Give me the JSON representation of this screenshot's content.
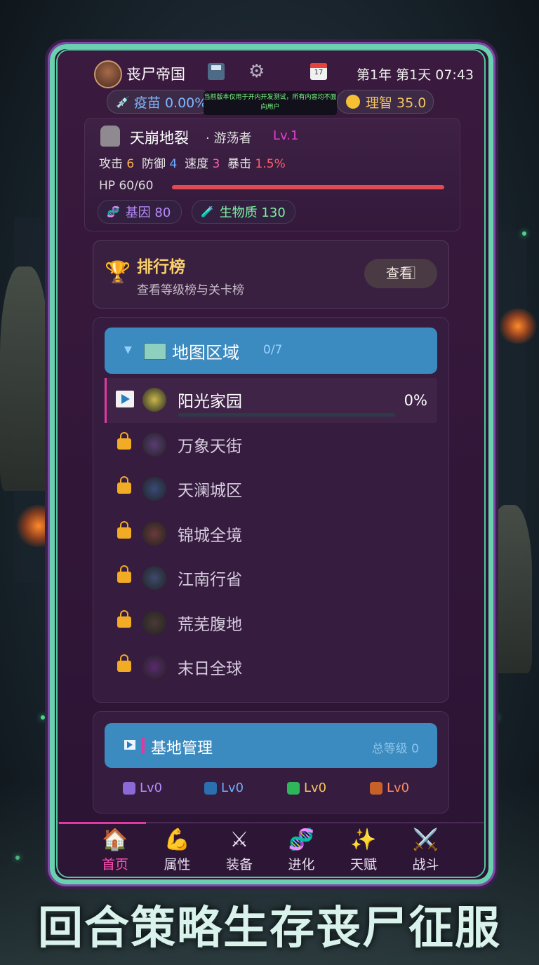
{
  "header": {
    "game_title": "丧尸帝国",
    "date_text": "第1年 第1天 07:43",
    "calendar_glyph": "17"
  },
  "resources_top": {
    "vaccine_label": "疫苗 0.00%",
    "sanity_label": "理智 35.0",
    "notice_text": "当前版本仅用于开内开发测试，所有内容均不面向用户"
  },
  "character": {
    "name": "天崩地裂",
    "role": "游荡者",
    "level": "Lv.1",
    "attack_label": "攻击",
    "attack_value": "6",
    "defense_label": "防御",
    "defense_value": "4",
    "speed_label": "速度",
    "speed_value": "3",
    "crit_label": "暴击",
    "crit_value": "1.5%",
    "hp_text": "HP 60/60",
    "hp_fraction": 1.0,
    "gene_label": "基因 80",
    "biomass_label": "生物质 130"
  },
  "leaderboard": {
    "title": "排行榜",
    "subtitle": "查看等级榜与关卡榜",
    "button_label": "查看 ⃞"
  },
  "map": {
    "title": "地图区域",
    "count": "0/7",
    "regions": [
      {
        "name": "阳光家园",
        "status": "active",
        "progress": "0%",
        "color": "#c8b84a"
      },
      {
        "name": "万象天街",
        "status": "locked",
        "color": "#5a3c74"
      },
      {
        "name": "天澜城区",
        "status": "locked",
        "color": "#3a4a78"
      },
      {
        "name": "锦城全境",
        "status": "locked",
        "color": "#6a3a3a"
      },
      {
        "name": "江南行省",
        "status": "locked",
        "color": "#3e4a6e"
      },
      {
        "name": "荒芜腹地",
        "status": "locked",
        "color": "#4a3a36"
      },
      {
        "name": "末日全球",
        "status": "locked",
        "color": "#5a2a6e"
      }
    ]
  },
  "base": {
    "title": "基地管理",
    "total_level": "总等级 0",
    "buildings": [
      {
        "level": "Lv0",
        "color": "#8b6ad8",
        "text_color": "#b58cff"
      },
      {
        "level": "Lv0",
        "color": "#2a6fb0",
        "text_color": "#6aaeff"
      },
      {
        "level": "Lv0",
        "color": "#2fb65a",
        "text_color": "#f5c460"
      },
      {
        "level": "Lv0",
        "color": "#c8602a",
        "text_color": "#ff8a5a"
      }
    ]
  },
  "nav": {
    "items": [
      {
        "label": "首页",
        "icon": "🏠",
        "active": true
      },
      {
        "label": "属性",
        "icon": "💪",
        "active": false
      },
      {
        "label": "装备",
        "icon": "⚔",
        "active": false
      },
      {
        "label": "进化",
        "icon": "🧬",
        "active": false
      },
      {
        "label": "天赋",
        "icon": "✨",
        "active": false
      },
      {
        "label": "战斗",
        "icon": "⚔️",
        "active": false
      }
    ]
  },
  "headline": "回合策略生存丧尸征服"
}
